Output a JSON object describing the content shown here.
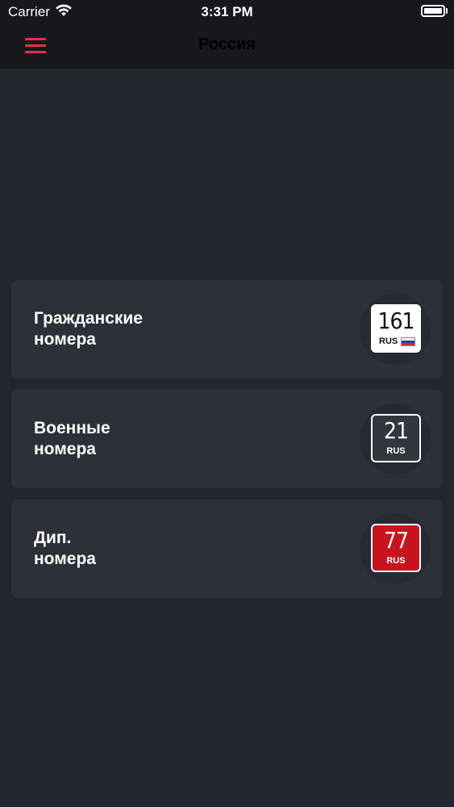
{
  "status_bar": {
    "carrier": "Carrier",
    "time": "3:31 PM",
    "battery_level": 1.0
  },
  "nav": {
    "title": "Россия",
    "menu_icon": "hamburger-menu-icon",
    "accent_color": "#e0353f"
  },
  "cards": [
    {
      "line1": "Гражданские",
      "line2": "номера",
      "plate_number": "161",
      "plate_code": "RUS",
      "plate_style": "civil",
      "plate_bg": "#ffffff",
      "flag_colors": [
        "#ffffff",
        "#1c3fb0",
        "#d52b1e"
      ]
    },
    {
      "line1": "Военные",
      "line2": "номера",
      "plate_number": "21",
      "plate_code": "RUS",
      "plate_style": "military",
      "plate_bg": "#32363d"
    },
    {
      "line1": "Дип.",
      "line2": "номера",
      "plate_number": "77",
      "plate_code": "RUS",
      "plate_style": "diplomatic",
      "plate_bg": "#c8141e"
    }
  ]
}
